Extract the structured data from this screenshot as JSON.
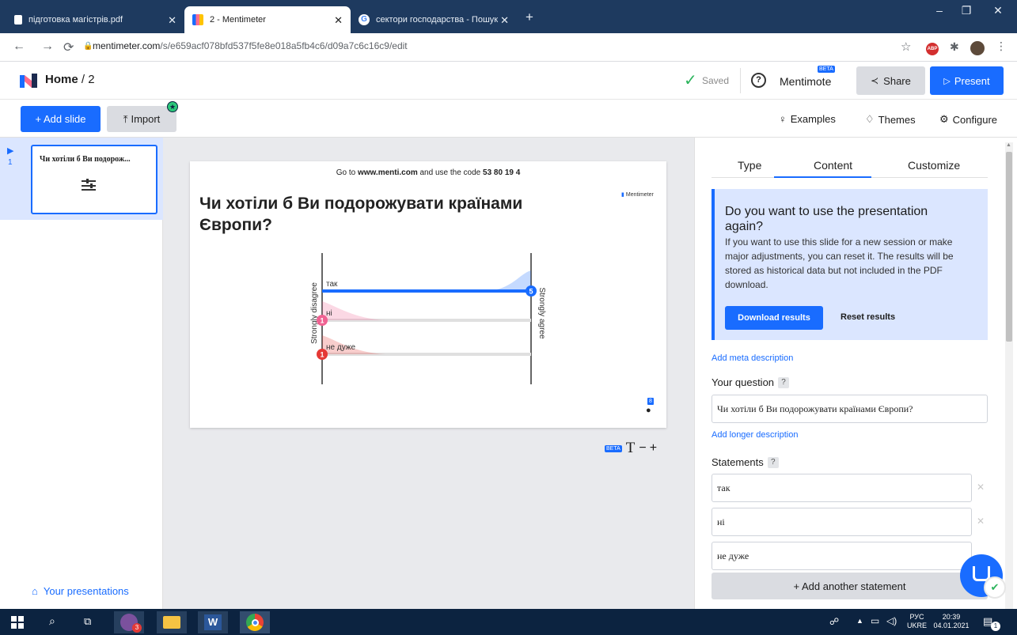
{
  "browser": {
    "tabs": [
      {
        "title": "підготовка магістрів.pdf"
      },
      {
        "title": "2 - Mentimeter"
      },
      {
        "title": "сектори господарства - Пошук"
      }
    ],
    "url_host": "mentimeter.com",
    "url_path": "/s/e659acf078bfd537f5fe8e018a5fb4c6/d09a7c6c16c9/edit",
    "new_tab_glyph": "+",
    "abp_label": "ABP"
  },
  "header": {
    "breadcrumb_home": "Home",
    "breadcrumb_sep": " / ",
    "breadcrumb_current": "2",
    "saved_label": "Saved",
    "mentimote_label": "Mentimote",
    "beta_badge": "BETA",
    "share_label": "Share",
    "present_label": "Present"
  },
  "toolbar": {
    "add_slide_label": "+ Add slide",
    "import_label": "Import",
    "examples_label": "Examples",
    "themes_label": "Themes",
    "configure_label": "Configure"
  },
  "sidebar": {
    "slide_number": "1",
    "slide_thumb_title": "Чи хотіли б Ви подорож...",
    "your_presentations_label": "Your presentations"
  },
  "slide": {
    "join_prefix": "Go to ",
    "join_site": "www.menti.com",
    "join_mid": " and use the code ",
    "join_code": "53 80 19 4",
    "brand": "Mentimeter",
    "question": "Чи хотіли б Ви подорожувати країнами Європи?",
    "left_axis_label": "Strongly disagree",
    "right_axis_label": "Strongly agree",
    "participants_count": "8",
    "text_size_beta": "BETA",
    "text_size_glyph": "T",
    "text_size_minus": "−",
    "text_size_plus": "+"
  },
  "chart_data": {
    "type": "scale",
    "statements": [
      {
        "label": "так",
        "value": 5,
        "color": "#196cff"
      },
      {
        "label": "ні",
        "value": 1,
        "color": "#f06292"
      },
      {
        "label": "не дуже",
        "value": 1,
        "color": "#e53935"
      }
    ],
    "scale_min": 1,
    "scale_max": 5
  },
  "panel": {
    "tab_type": "Type",
    "tab_content": "Content",
    "tab_customize": "Customize",
    "notice_title": "Do you want to use the presentation again?",
    "notice_body": "If you want to use this slide for a new session or make major adjustments, you can reset it. The results will be stored as historical data but not included in the PDF download.",
    "download_results_label": "Download results",
    "reset_results_label": "Reset results",
    "add_meta_description": "Add meta description",
    "your_question_label": "Your question",
    "help_mark": "?",
    "question_value": "Чи хотіли б Ви подорожувати країнами Європи?",
    "add_longer_description": "Add longer description",
    "statements_label": "Statements",
    "statements": [
      "так",
      "ні",
      "не дуже"
    ],
    "add_statement_label": "+ Add another statement"
  },
  "taskbar": {
    "viber_badge": "3",
    "lang_top": "РУС",
    "lang_bottom": "UKRE",
    "time": "20:39",
    "date": "04.01.2021",
    "notif_count": "1"
  }
}
